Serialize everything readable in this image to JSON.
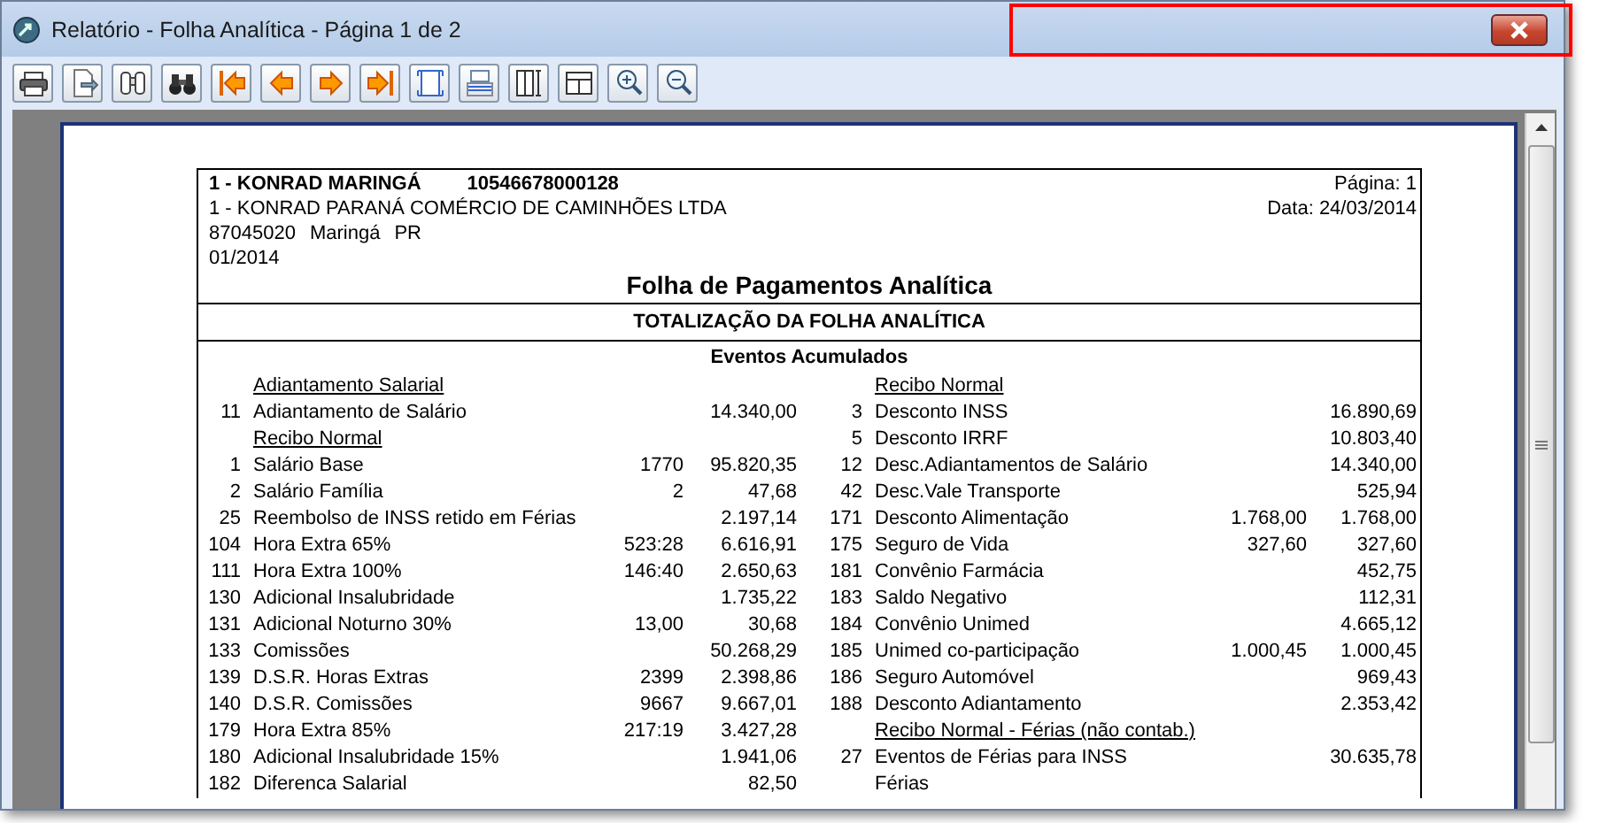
{
  "window": {
    "title": "Relatório - Folha Analítica - Página 1 de 2"
  },
  "report": {
    "company_line": "1 - KONRAD MARINGÁ",
    "company_id": "10546678000128",
    "page_label": "Página: 1",
    "legal_name": "1 - KONRAD PARANÁ COMÉRCIO DE CAMINHÕES LTDA",
    "date_label": "Data: 24/03/2014",
    "address": [
      "87045020",
      "Maringá",
      "PR"
    ],
    "period": "01/2014",
    "title": "Folha de Pagamentos Analítica",
    "section_title": "TOTALIZAÇÃO DA FOLHA ANALÍTICA",
    "group_title": "Eventos Acumulados",
    "rows": [
      {
        "left": {
          "kind": "heading",
          "description": "Adiantamento Salarial"
        },
        "right": {
          "kind": "heading",
          "description": "Recibo Normal"
        }
      },
      {
        "left": {
          "kind": "item",
          "code": "11",
          "description": "Adiantamento de Salário",
          "value": "14.340,00"
        },
        "right": {
          "kind": "item",
          "code": "3",
          "description": "Desconto INSS",
          "value": "16.890,69"
        }
      },
      {
        "left": {
          "kind": "heading",
          "description": "Recibo Normal"
        },
        "right": {
          "kind": "item",
          "code": "5",
          "description": "Desconto IRRF",
          "value": "10.803,40"
        }
      },
      {
        "left": {
          "kind": "item",
          "code": "1",
          "description": "Salário Base",
          "reference": "1770",
          "value": "95.820,35"
        },
        "right": {
          "kind": "item",
          "code": "12",
          "description": "Desc.Adiantamentos de Salário",
          "value": "14.340,00"
        }
      },
      {
        "left": {
          "kind": "item",
          "code": "2",
          "description": "Salário Família",
          "reference": "2",
          "value": "47,68"
        },
        "right": {
          "kind": "item",
          "code": "42",
          "description": "Desc.Vale Transporte",
          "value": "525,94"
        }
      },
      {
        "left": {
          "kind": "item",
          "code": "25",
          "description": "Reembolso de INSS retido em Férias",
          "value": "2.197,14"
        },
        "right": {
          "kind": "item",
          "code": "171",
          "description": "Desconto Alimentação",
          "reference": "1.768,00",
          "value": "1.768,00"
        }
      },
      {
        "left": {
          "kind": "item",
          "code": "104",
          "description": "Hora Extra 65%",
          "reference": "523:28",
          "value": "6.616,91"
        },
        "right": {
          "kind": "item",
          "code": "175",
          "description": "Seguro de Vida",
          "reference": "327,60",
          "value": "327,60"
        }
      },
      {
        "left": {
          "kind": "item",
          "code": "111",
          "description": "Hora Extra 100%",
          "reference": "146:40",
          "value": "2.650,63"
        },
        "right": {
          "kind": "item",
          "code": "181",
          "description": "Convênio Farmácia",
          "value": "452,75"
        }
      },
      {
        "left": {
          "kind": "item",
          "code": "130",
          "description": "Adicional Insalubridade",
          "value": "1.735,22"
        },
        "right": {
          "kind": "item",
          "code": "183",
          "description": "Saldo Negativo",
          "value": "112,31"
        }
      },
      {
        "left": {
          "kind": "item",
          "code": "131",
          "description": "Adicional Noturno 30%",
          "reference": "13,00",
          "value": "30,68"
        },
        "right": {
          "kind": "item",
          "code": "184",
          "description": "Convênio Unimed",
          "value": "4.665,12"
        }
      },
      {
        "left": {
          "kind": "item",
          "code": "133",
          "description": "Comissões",
          "value": "50.268,29"
        },
        "right": {
          "kind": "item",
          "code": "185",
          "description": "Unimed co-participação",
          "reference": "1.000,45",
          "value": "1.000,45"
        }
      },
      {
        "left": {
          "kind": "item",
          "code": "139",
          "description": "D.S.R. Horas Extras",
          "reference": "2399",
          "value": "2.398,86"
        },
        "right": {
          "kind": "item",
          "code": "186",
          "description": "Seguro Automóvel",
          "value": "969,43"
        }
      },
      {
        "left": {
          "kind": "item",
          "code": "140",
          "description": "D.S.R. Comissões",
          "reference": "9667",
          "value": "9.667,01"
        },
        "right": {
          "kind": "item",
          "code": "188",
          "description": "Desconto Adiantamento",
          "value": "2.353,42"
        }
      },
      {
        "left": {
          "kind": "item",
          "code": "179",
          "description": "Hora Extra 85%",
          "reference": "217:19",
          "value": "3.427,28"
        },
        "right": {
          "kind": "heading",
          "description": "Recibo Normal - Férias (não contab.)"
        }
      },
      {
        "left": {
          "kind": "item",
          "code": "180",
          "description": "Adicional Insalubridade 15%",
          "value": "1.941,06"
        },
        "right": {
          "kind": "item",
          "code": "27",
          "description": "Eventos de Férias para INSS",
          "value": "30.635,78"
        }
      },
      {
        "left": {
          "kind": "item",
          "code": "182",
          "description": "Diferenca Salarial",
          "value": "82,50"
        },
        "right": {
          "kind": "item",
          "description": "Férias"
        }
      }
    ]
  }
}
